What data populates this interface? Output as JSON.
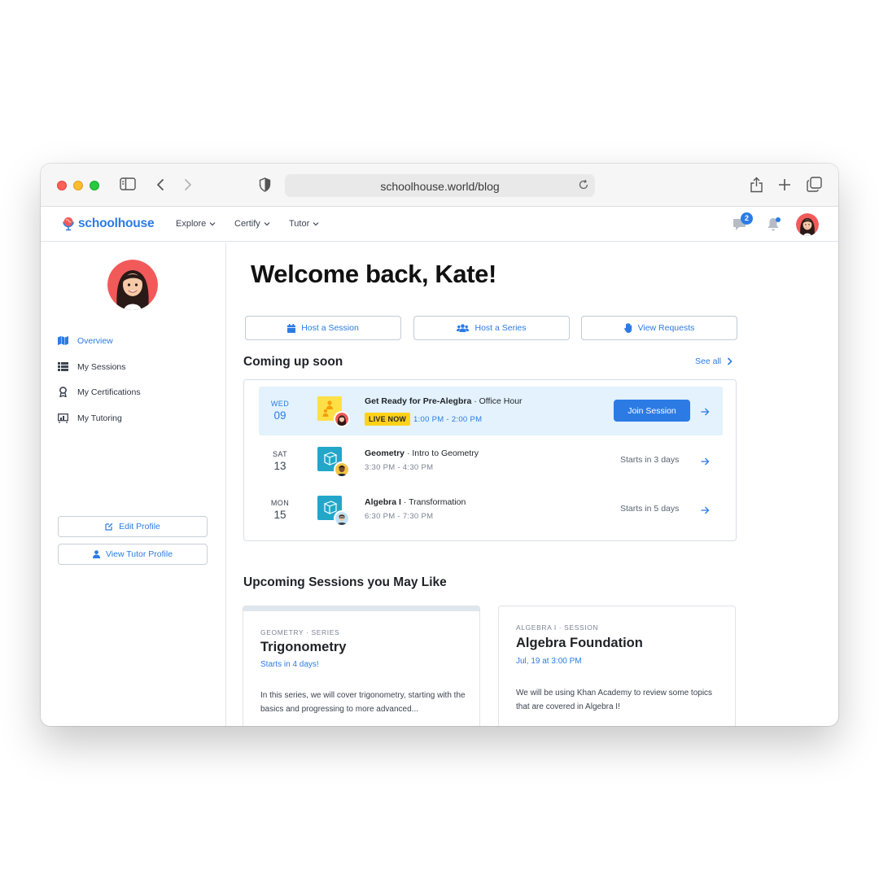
{
  "browser": {
    "url": "schoolhouse.world/blog"
  },
  "site": {
    "logo_text": "schoolhouse",
    "nav": [
      {
        "label": "Explore"
      },
      {
        "label": "Certify"
      },
      {
        "label": "Tutor"
      }
    ],
    "messages_badge": "2"
  },
  "sidebar": {
    "items": [
      {
        "label": "Overview",
        "icon": "map-icon",
        "active": true
      },
      {
        "label": "My Sessions",
        "icon": "list-icon",
        "active": false
      },
      {
        "label": "My Certifications",
        "icon": "award-icon",
        "active": false
      },
      {
        "label": "My Tutoring",
        "icon": "presentation-icon",
        "active": false
      }
    ],
    "edit_profile": "Edit Profile",
    "view_tutor_profile": "View Tutor Profile"
  },
  "main": {
    "welcome": "Welcome back, Kate!",
    "actions": [
      {
        "label": "Host a Session",
        "icon": "calendar-icon"
      },
      {
        "label": "Host a Series",
        "icon": "users-icon"
      },
      {
        "label": "View Requests",
        "icon": "hand-icon"
      }
    ],
    "coming_up_title": "Coming up soon",
    "see_all": "See all",
    "sessions": [
      {
        "dow": "WED",
        "day": "09",
        "subject": "Get Ready for Pre-Alegbra",
        "topic": " · Office Hour",
        "live_label": "LIVE NOW",
        "time": "1:00 PM - 2:00 PM",
        "join_label": "Join Session"
      },
      {
        "dow": "SAT",
        "day": "13",
        "subject": "Geometry",
        "topic": " · Intro to Geometry",
        "time": "3:30 PM - 4:30 PM",
        "starts": "Starts in 3 days"
      },
      {
        "dow": "MON",
        "day": "15",
        "subject": "Algebra I",
        "topic": " · Transformation",
        "time": "6:30 PM - 7:30 PM",
        "starts": "Starts in 5 days"
      }
    ],
    "upcoming_title": "Upcoming Sessions you May Like",
    "cards": [
      {
        "kicker": "GEOMETRY · SERIES",
        "title": "Trigonometry",
        "sub": "Starts in 4 days!",
        "desc": "In this series, we will cover trigonometry, starting with the basics and progressing to more advanced..."
      },
      {
        "kicker": "ALGEBRA I · SESSION",
        "title": "Algebra Foundation",
        "sub": "Jul, 19 at 3:00 PM",
        "desc": "We will be using Khan Academy to review some topics that are covered in Algebra I!"
      }
    ]
  },
  "colors": {
    "accent": "#2c7be5",
    "live_highlight": "#e3f2fc",
    "live_tag": "#ffd21a"
  }
}
